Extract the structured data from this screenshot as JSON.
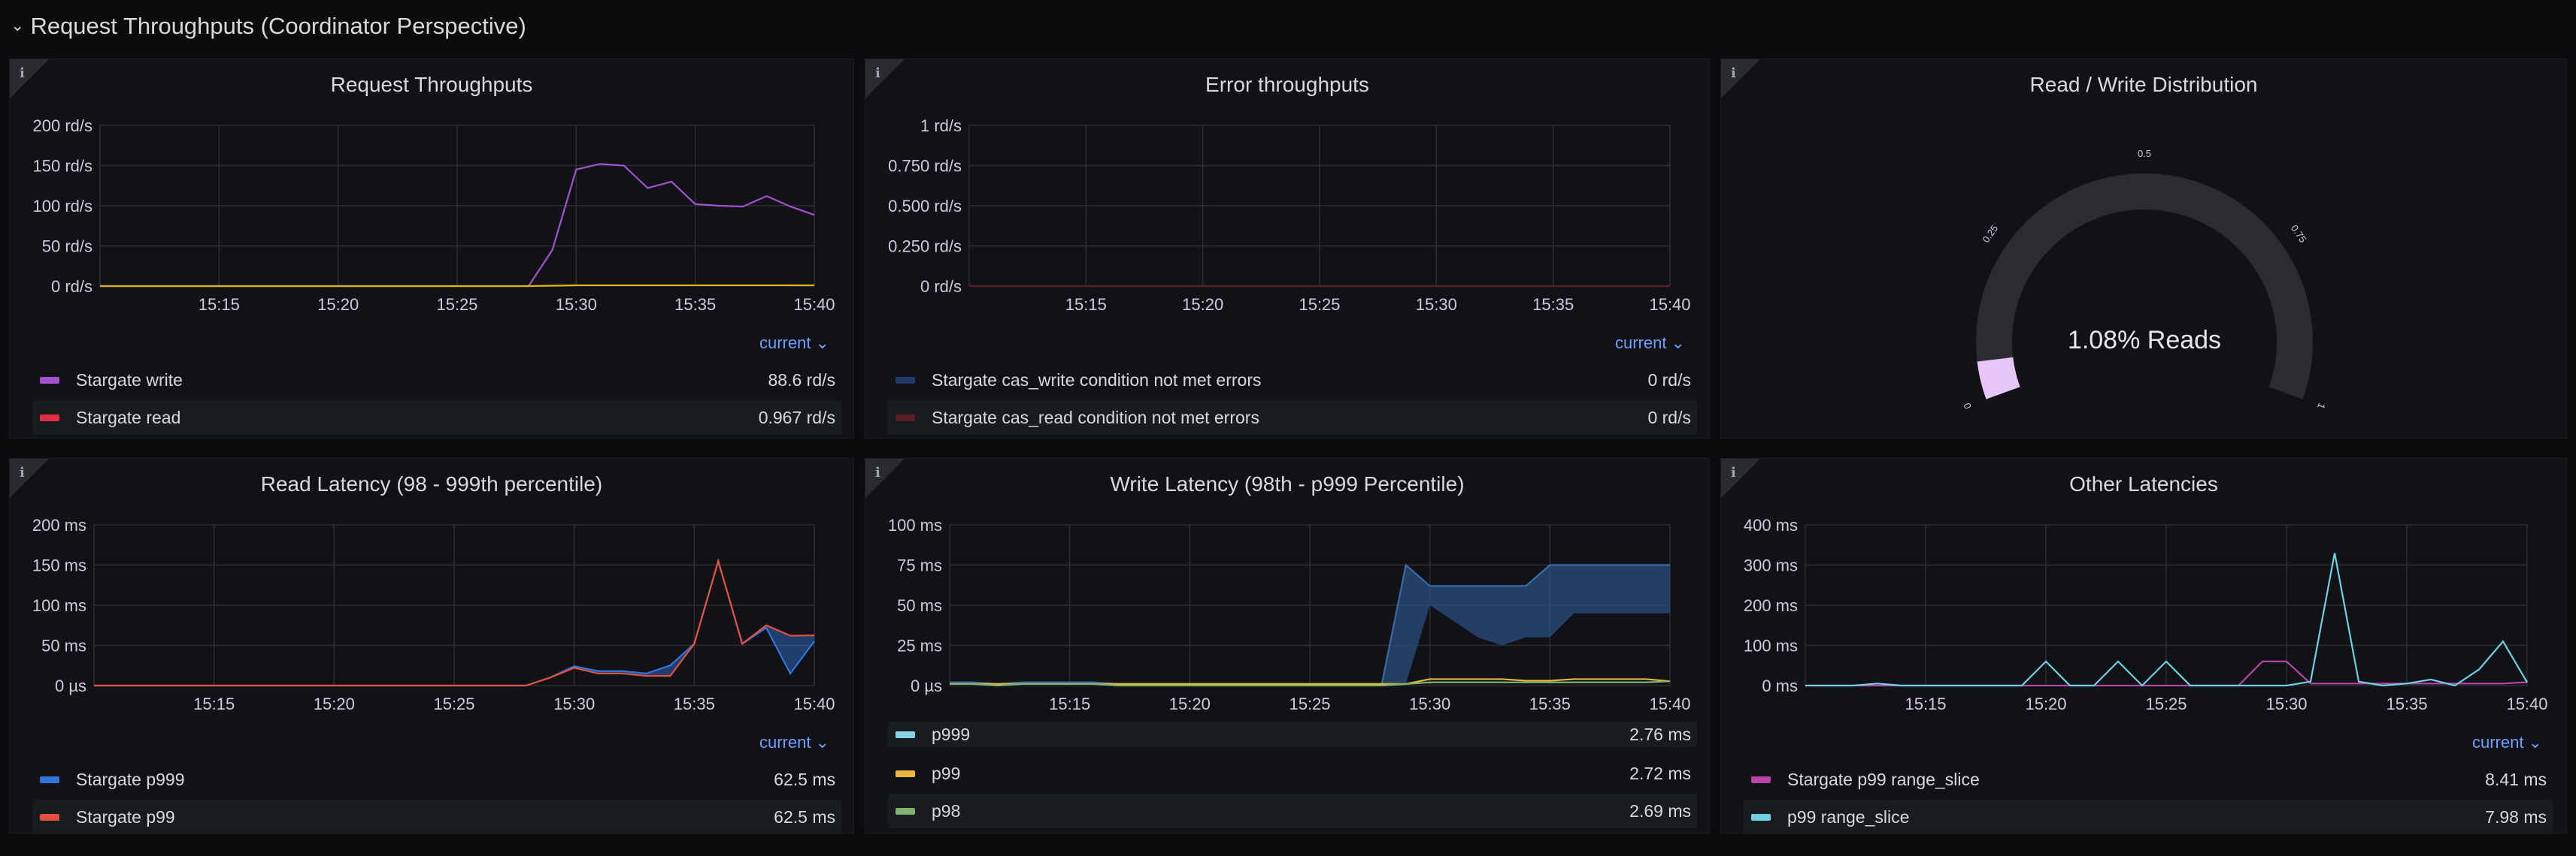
{
  "row": {
    "title": "Request Throughputs (Coordinator Perspective)",
    "chevron": "⌄"
  },
  "panels": {
    "request_throughputs": {
      "title": "Request Throughputs",
      "sort_label": "current ⌄",
      "legend": [
        {
          "name": "Stargate write",
          "value": "88.6 rd/s",
          "color": "#a352cc"
        },
        {
          "name": "Stargate read",
          "value": "0.967 rd/s",
          "color": "#e02f44"
        }
      ]
    },
    "error_throughputs": {
      "title": "Error throughputs",
      "sort_label": "current ⌄",
      "legend": [
        {
          "name": "Stargate cas_write condition not met errors",
          "value": "0 rd/s",
          "color": "#1f3a66"
        },
        {
          "name": "Stargate cas_read condition not met errors",
          "value": "0 rd/s",
          "color": "#5c1f24"
        }
      ]
    },
    "rw_distribution": {
      "title": "Read / Write Distribution",
      "value_text": "1.08% Reads",
      "ticks": [
        "0",
        "0.25",
        "0.5",
        "0.75",
        "1"
      ],
      "gauge_value": 0.0108
    },
    "read_latency": {
      "title": "Read Latency (98 - 999th percentile)",
      "sort_label": "current ⌄",
      "legend": [
        {
          "name": "Stargate p999",
          "value": "62.5 ms",
          "color": "#3274d9"
        },
        {
          "name": "Stargate p99",
          "value": "62.5 ms",
          "color": "#e0523f"
        }
      ]
    },
    "write_latency": {
      "title": "Write Latency (98th - p999 Percentile)",
      "legend": [
        {
          "name": "p999",
          "value": "2.76 ms",
          "color": "#8ad1e6"
        },
        {
          "name": "p99",
          "value": "2.72 ms",
          "color": "#eab839"
        },
        {
          "name": "p98",
          "value": "2.69 ms",
          "color": "#7eb26d"
        }
      ]
    },
    "other_latencies": {
      "title": "Other Latencies",
      "sort_label": "current ⌄",
      "legend": [
        {
          "name": "Stargate p99 range_slice",
          "value": "8.41 ms",
          "color": "#ba43a9"
        },
        {
          "name": "p99 range_slice",
          "value": "7.98 ms",
          "color": "#6ed0e0"
        }
      ]
    }
  },
  "chart_data": [
    {
      "type": "line",
      "id": "request_throughputs",
      "x_ticks": [
        "15:15",
        "15:20",
        "15:25",
        "15:30",
        "15:35",
        "15:40"
      ],
      "y_ticks": [
        "0 rd/s",
        "50 rd/s",
        "100 rd/s",
        "150 rd/s",
        "200 rd/s"
      ],
      "ylim": [
        0,
        200
      ],
      "x": [
        "15:10",
        "15:11",
        "15:12",
        "15:13",
        "15:14",
        "15:15",
        "15:16",
        "15:17",
        "15:18",
        "15:19",
        "15:20",
        "15:21",
        "15:22",
        "15:23",
        "15:24",
        "15:25",
        "15:26",
        "15:27",
        "15:28",
        "15:29",
        "15:30",
        "15:31",
        "15:32",
        "15:33",
        "15:34",
        "15:35",
        "15:36",
        "15:37",
        "15:38",
        "15:39",
        "15:40"
      ],
      "series": [
        {
          "name": "Stargate write",
          "color": "#a352cc",
          "values": [
            0,
            0,
            0,
            0,
            0,
            0,
            0,
            0,
            0,
            0,
            0,
            0,
            0,
            0,
            0,
            0,
            0,
            0,
            0,
            45,
            145,
            152,
            150,
            122,
            130,
            102,
            100,
            99,
            112,
            99,
            88.6
          ]
        },
        {
          "name": "Stargate read",
          "color": "#e0b400",
          "values": [
            0,
            0,
            0,
            0,
            0,
            0,
            0,
            0,
            0,
            0,
            0,
            0,
            0,
            0,
            0,
            0,
            0,
            0,
            0,
            0.5,
            1,
            1,
            1,
            1,
            1,
            1,
            1,
            1,
            1,
            1,
            0.967
          ]
        }
      ]
    },
    {
      "type": "line",
      "id": "error_throughputs",
      "x_ticks": [
        "15:15",
        "15:20",
        "15:25",
        "15:30",
        "15:35",
        "15:40"
      ],
      "y_ticks": [
        "0 rd/s",
        "0.250 rd/s",
        "0.500 rd/s",
        "0.750 rd/s",
        "1 rd/s"
      ],
      "ylim": [
        0,
        1
      ],
      "x": [
        "15:10",
        "15:40"
      ],
      "series": [
        {
          "name": "Stargate cas_write condition not met errors",
          "color": "#1f3a66",
          "values": [
            0,
            0
          ]
        },
        {
          "name": "Stargate cas_read condition not met errors",
          "color": "#5c1f24",
          "values": [
            0,
            0
          ]
        }
      ]
    },
    {
      "type": "line",
      "id": "read_latency",
      "x_ticks": [
        "15:15",
        "15:20",
        "15:25",
        "15:30",
        "15:35",
        "15:40"
      ],
      "y_ticks": [
        "0 µs",
        "50 ms",
        "100 ms",
        "150 ms",
        "200 ms"
      ],
      "ylim": [
        0,
        200
      ],
      "x": [
        "15:10",
        "15:11",
        "15:12",
        "15:13",
        "15:14",
        "15:15",
        "15:16",
        "15:17",
        "15:18",
        "15:19",
        "15:20",
        "15:21",
        "15:22",
        "15:23",
        "15:24",
        "15:25",
        "15:26",
        "15:27",
        "15:28",
        "15:29",
        "15:30",
        "15:31",
        "15:32",
        "15:33",
        "15:34",
        "15:35",
        "15:36",
        "15:37",
        "15:38",
        "15:39",
        "15:40"
      ],
      "series": [
        {
          "name": "Stargate p999",
          "color": "#3274d9",
          "values": [
            0,
            0,
            0,
            0,
            0,
            0,
            0,
            0,
            0,
            0,
            0,
            0,
            0,
            0,
            0,
            0,
            0,
            0,
            0,
            10,
            24,
            18,
            18,
            15,
            25,
            52,
            155,
            52,
            72,
            15,
            55
          ]
        },
        {
          "name": "Stargate p99",
          "color": "#e0523f",
          "values": [
            0,
            0,
            0,
            0,
            0,
            0,
            0,
            0,
            0,
            0,
            0,
            0,
            0,
            0,
            0,
            0,
            0,
            0,
            0,
            10,
            22,
            15,
            15,
            12,
            12,
            52,
            155,
            52,
            75,
            62,
            62.5
          ]
        }
      ]
    },
    {
      "type": "line",
      "id": "write_latency",
      "x_ticks": [
        "15:15",
        "15:20",
        "15:25",
        "15:30",
        "15:35",
        "15:40"
      ],
      "y_ticks": [
        "0 µs",
        "25 ms",
        "50 ms",
        "75 ms",
        "100 ms"
      ],
      "ylim": [
        0,
        100
      ],
      "x": [
        "15:10",
        "15:11",
        "15:12",
        "15:13",
        "15:14",
        "15:15",
        "15:16",
        "15:17",
        "15:18",
        "15:19",
        "15:20",
        "15:21",
        "15:22",
        "15:23",
        "15:24",
        "15:25",
        "15:26",
        "15:27",
        "15:28",
        "15:29",
        "15:30",
        "15:31",
        "15:32",
        "15:33",
        "15:34",
        "15:35",
        "15:36",
        "15:37",
        "15:38",
        "15:39",
        "15:40"
      ],
      "series": [
        {
          "name": "p999",
          "color": "#3c6aa8",
          "values": [
            2,
            2,
            1,
            2,
            2,
            2,
            2,
            1,
            1,
            1,
            1,
            1,
            1,
            1,
            1,
            1,
            1,
            1,
            1,
            75,
            62,
            62,
            62,
            62,
            62,
            75,
            75,
            75,
            75,
            75,
            75
          ]
        },
        {
          "name": "p99",
          "color": "#eab839",
          "values": [
            1,
            1,
            1,
            1,
            1,
            1,
            1,
            1,
            1,
            1,
            1,
            1,
            1,
            1,
            1,
            1,
            1,
            1,
            1,
            1,
            4,
            4,
            4,
            4,
            3,
            3,
            4,
            4,
            4,
            4,
            2.72
          ]
        },
        {
          "name": "p98",
          "color": "#7eb26d",
          "values": [
            1,
            1,
            0,
            1,
            1,
            1,
            1,
            0,
            0,
            0,
            0,
            0,
            0,
            0,
            0,
            0,
            0,
            0,
            0,
            1,
            2,
            2,
            2,
            2,
            2,
            2,
            2,
            2,
            2,
            2,
            2.69
          ]
        }
      ]
    },
    {
      "type": "line",
      "id": "other_latencies",
      "x_ticks": [
        "15:15",
        "15:20",
        "15:25",
        "15:30",
        "15:35",
        "15:40"
      ],
      "y_ticks": [
        "0 ms",
        "100 ms",
        "200 ms",
        "300 ms",
        "400 ms"
      ],
      "ylim": [
        0,
        400
      ],
      "x": [
        "15:10",
        "15:11",
        "15:12",
        "15:13",
        "15:14",
        "15:15",
        "15:16",
        "15:17",
        "15:18",
        "15:19",
        "15:20",
        "15:21",
        "15:22",
        "15:23",
        "15:24",
        "15:25",
        "15:26",
        "15:27",
        "15:28",
        "15:29",
        "15:30",
        "15:31",
        "15:32",
        "15:33",
        "15:34",
        "15:35",
        "15:36",
        "15:37",
        "15:38",
        "15:39",
        "15:40"
      ],
      "series": [
        {
          "name": "Stargate p99 range_slice",
          "color": "#ba43a9",
          "values": [
            0,
            0,
            0,
            0,
            0,
            0,
            0,
            0,
            0,
            0,
            0,
            0,
            0,
            0,
            0,
            0,
            0,
            0,
            0,
            60,
            60,
            5,
            5,
            5,
            5,
            5,
            5,
            5,
            5,
            5,
            8.41
          ]
        },
        {
          "name": "p99 range_slice",
          "color": "#6ed0e0",
          "values": [
            0,
            0,
            0,
            5,
            0,
            0,
            0,
            0,
            0,
            0,
            60,
            0,
            0,
            60,
            0,
            60,
            0,
            0,
            0,
            0,
            0,
            10,
            330,
            10,
            0,
            5,
            15,
            0,
            40,
            110,
            7.98
          ]
        }
      ]
    }
  ]
}
